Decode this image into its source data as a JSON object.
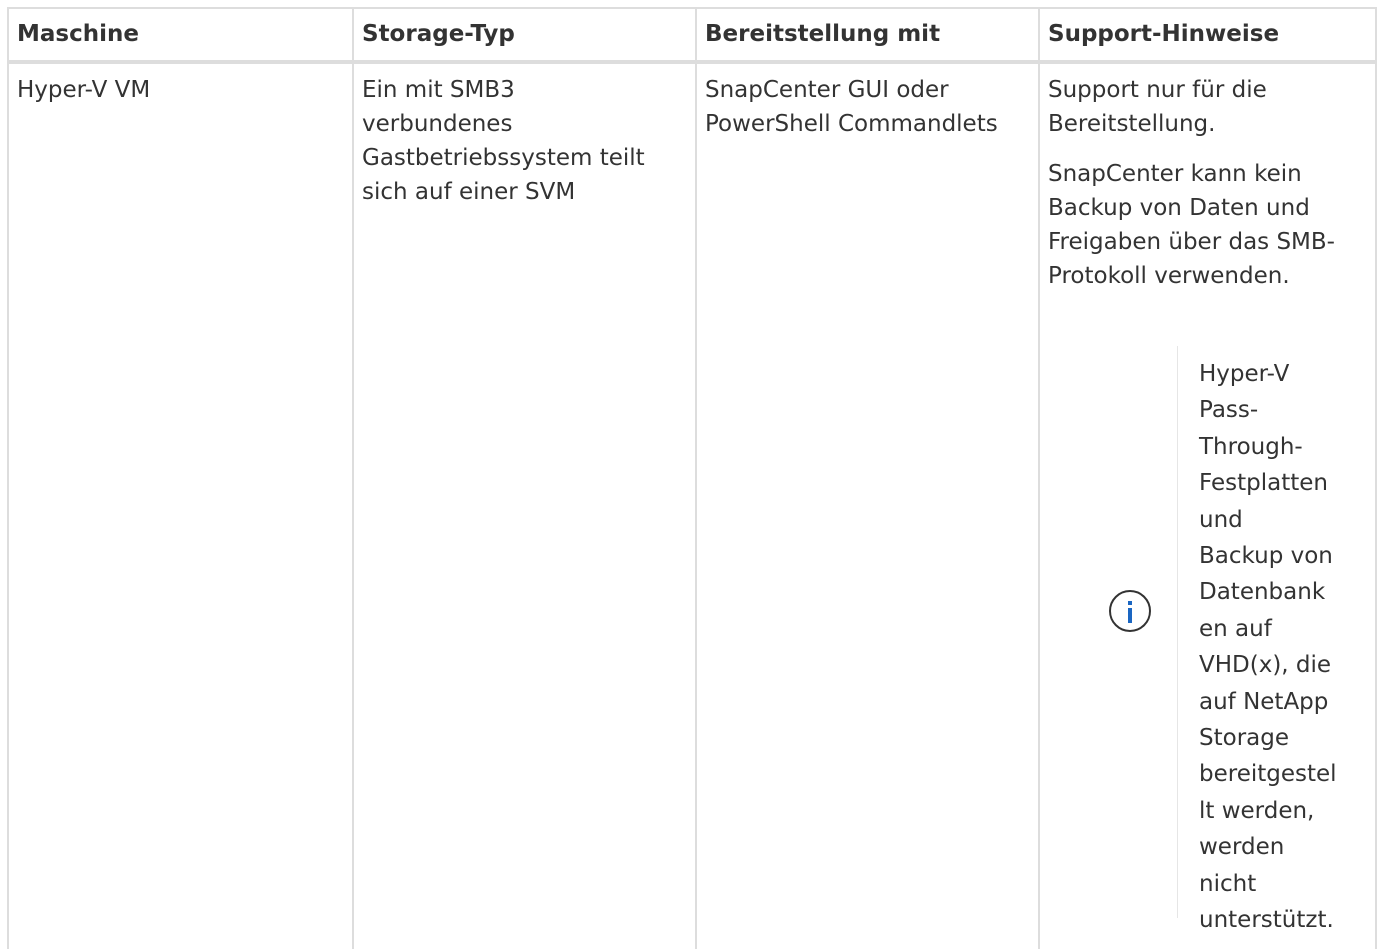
{
  "table": {
    "headers": [
      "Maschine",
      "Storage-Typ",
      "Bereitstellung mit",
      "Support-Hinweise"
    ],
    "row": {
      "maschine": "Hyper-V VM",
      "storage_typ": "Ein mit SMB3 verbundenes Gastbetriebssystem teilt sich auf einer SVM",
      "bereitstellung": "SnapCenter GUI oder PowerShell Commandlets",
      "support_hinweise": [
        "Support nur für die Bereitstellung.",
        "SnapCenter kann kein Backup von Daten und Freigaben über das SMB-Protokoll verwenden."
      ],
      "note": {
        "icon": "info-icon",
        "lines": [
          "Hyper-V",
          "Pass-",
          "Through-",
          "Festplatten",
          "und",
          "Backup von",
          "Datenbank",
          "en auf",
          "VHD(x), die",
          "auf NetApp",
          "Storage",
          "bereitgestel",
          "lt werden,",
          "werden",
          "nicht",
          "unterstützt."
        ]
      }
    }
  },
  "colors": {
    "border": "#dddddd",
    "text": "#333333",
    "icon_accent": "#1a66c2"
  }
}
